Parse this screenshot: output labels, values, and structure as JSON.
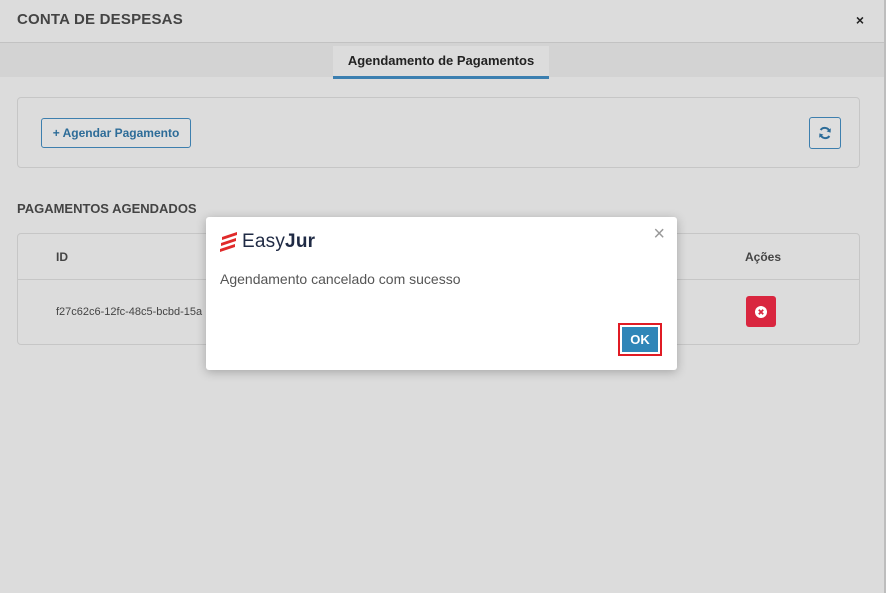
{
  "window": {
    "title": "CONTA DE DESPESAS",
    "close_label": "×"
  },
  "tabs": [
    {
      "label": "Agendamento de Pagamentos",
      "active": true
    }
  ],
  "toolbar": {
    "add_label": "+ Agendar Pagamento",
    "refresh_icon": "refresh-icon"
  },
  "section": {
    "title": "PAGAMENTOS AGENDADOS"
  },
  "table": {
    "headers": {
      "id": "ID",
      "actions": "Ações"
    },
    "rows": [
      {
        "id": "f27c62c6-12fc-48c5-bcbd-15a"
      }
    ]
  },
  "dialog": {
    "logo_text_light": "Easy",
    "logo_text_bold": "Jur",
    "close_label": "×",
    "message": "Agendamento cancelado com sucesso",
    "ok_label": "OK"
  },
  "colors": {
    "accent": "#3b7fb0",
    "ok_button": "#2f86b8",
    "danger": "#d9263f",
    "highlight_border": "#e01b24",
    "logo_red": "#e02a2a"
  }
}
